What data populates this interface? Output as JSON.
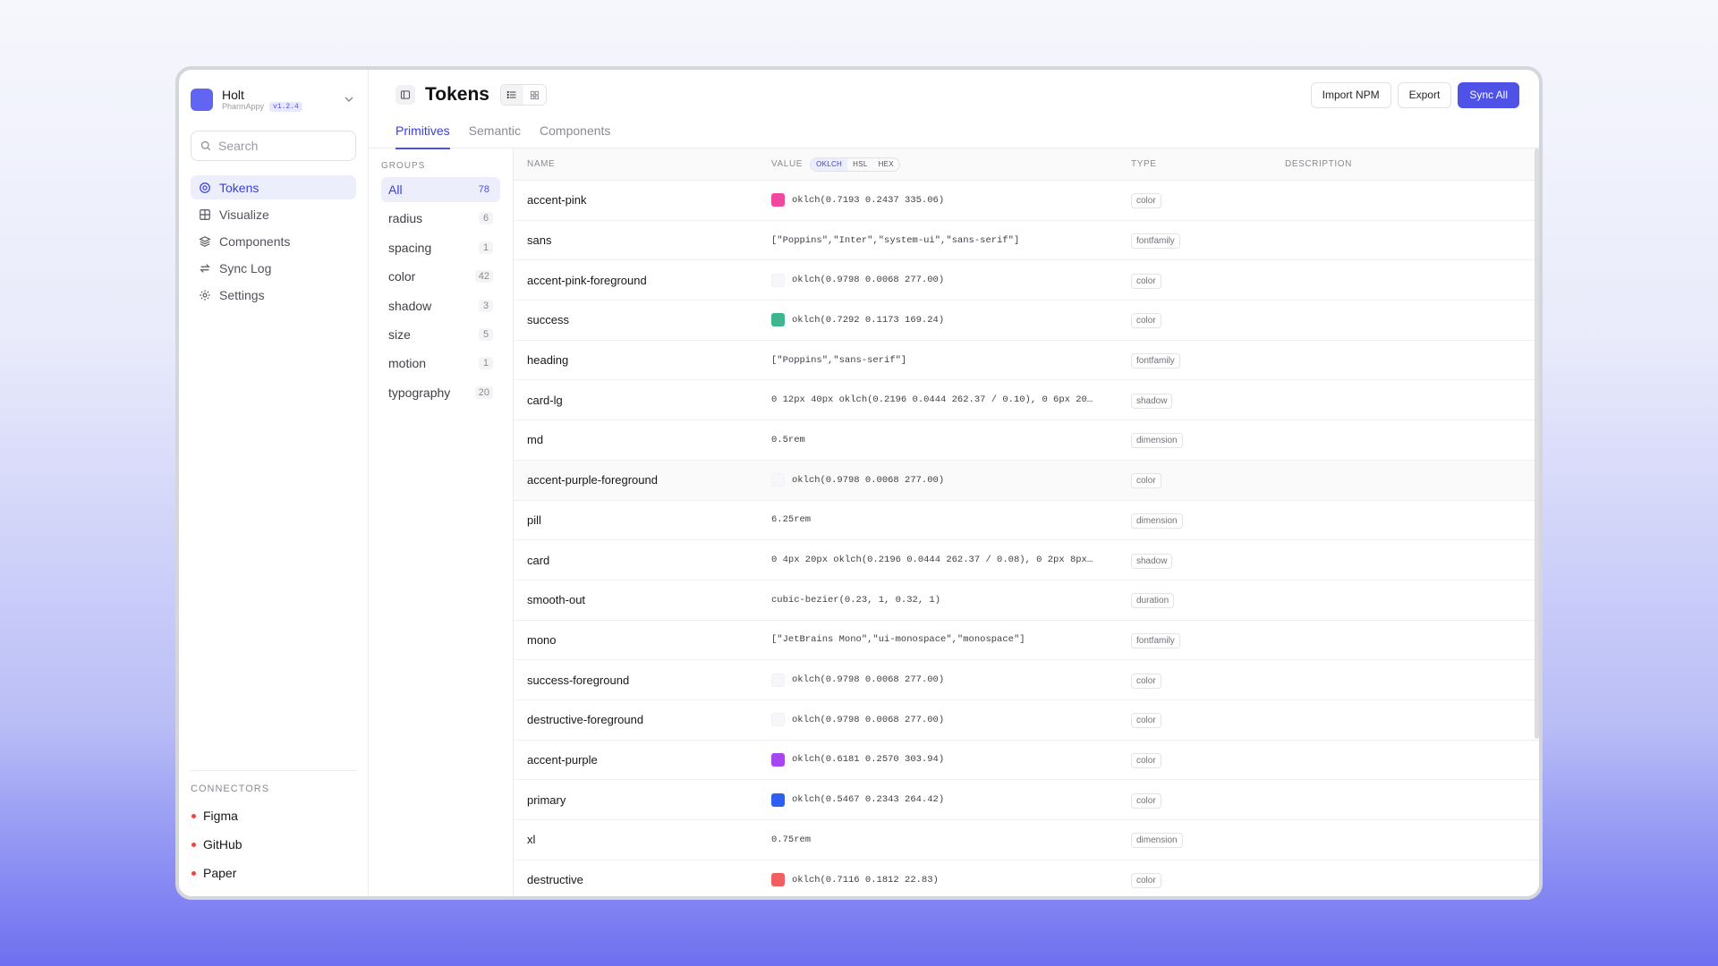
{
  "workspace": {
    "name": "Holt",
    "project": "PharmAppy",
    "version": "v1.2.4"
  },
  "search": {
    "placeholder": "Search"
  },
  "nav": [
    {
      "label": "Tokens",
      "icon": "target-icon",
      "active": true
    },
    {
      "label": "Visualize",
      "icon": "grid-icon",
      "active": false
    },
    {
      "label": "Components",
      "icon": "layers-icon",
      "active": false
    },
    {
      "label": "Sync Log",
      "icon": "sync-icon",
      "active": false
    },
    {
      "label": "Settings",
      "icon": "gear-icon",
      "active": false
    }
  ],
  "connectors": {
    "title": "CONNECTORS",
    "items": [
      "Figma",
      "GitHub",
      "Paper"
    ],
    "status_color": "#ef4444"
  },
  "header": {
    "title": "Tokens",
    "import_label": "Import NPM",
    "export_label": "Export",
    "sync_label": "Sync All"
  },
  "tabs": [
    {
      "label": "Primitives",
      "active": true
    },
    {
      "label": "Semantic",
      "active": false
    },
    {
      "label": "Components",
      "active": false
    }
  ],
  "groups": {
    "title": "GROUPS",
    "items": [
      {
        "label": "All",
        "count": "78",
        "active": true
      },
      {
        "label": "radius",
        "count": "6"
      },
      {
        "label": "spacing",
        "count": "1"
      },
      {
        "label": "color",
        "count": "42"
      },
      {
        "label": "shadow",
        "count": "3"
      },
      {
        "label": "size",
        "count": "5"
      },
      {
        "label": "motion",
        "count": "1"
      },
      {
        "label": "typography",
        "count": "20"
      }
    ]
  },
  "table": {
    "headers": {
      "name": "NAME",
      "value": "VALUE",
      "type": "TYPE",
      "description": "DESCRIPTION"
    },
    "formats": [
      "OKLCH",
      "HSL",
      "HEX"
    ],
    "active_format": "OKLCH",
    "rows": [
      {
        "name": "accent-pink",
        "value": "oklch(0.7193 0.2437 335.06)",
        "type": "color",
        "swatch": "#f0489f"
      },
      {
        "name": "sans",
        "value": "[\"Poppins\",\"Inter\",\"system-ui\",\"sans-serif\"]",
        "type": "fontfamily"
      },
      {
        "name": "accent-pink-foreground",
        "value": "oklch(0.9798 0.0068 277.00)",
        "type": "color",
        "swatch": "#f6f6fb"
      },
      {
        "name": "success",
        "value": "oklch(0.7292 0.1173 169.24)",
        "type": "color",
        "swatch": "#3fb58f"
      },
      {
        "name": "heading",
        "value": "[\"Poppins\",\"sans-serif\"]",
        "type": "fontfamily"
      },
      {
        "name": "card-lg",
        "value": "0 12px 40px oklch(0.2196 0.0444 262.37 / 0.10), 0 6px 20…",
        "type": "shadow"
      },
      {
        "name": "md",
        "value": "0.5rem",
        "type": "dimension"
      },
      {
        "name": "accent-purple-foreground",
        "value": "oklch(0.9798 0.0068 277.00)",
        "type": "color",
        "swatch": "#f6f6fb"
      },
      {
        "name": "pill",
        "value": "6.25rem",
        "type": "dimension"
      },
      {
        "name": "card",
        "value": "0 4px 20px oklch(0.2196 0.0444 262.37 / 0.08), 0 2px 8px…",
        "type": "shadow"
      },
      {
        "name": "smooth-out",
        "value": "cubic-bezier(0.23, 1, 0.32, 1)",
        "type": "duration"
      },
      {
        "name": "mono",
        "value": "[\"JetBrains Mono\",\"ui-monospace\",\"monospace\"]",
        "type": "fontfamily"
      },
      {
        "name": "success-foreground",
        "value": "oklch(0.9798 0.0068 277.00)",
        "type": "color",
        "swatch": "#f6f6fb"
      },
      {
        "name": "destructive-foreground",
        "value": "oklch(0.9798 0.0068 277.00)",
        "type": "color",
        "swatch": "#f6f6fb"
      },
      {
        "name": "accent-purple",
        "value": "oklch(0.6181 0.2570 303.94)",
        "type": "color",
        "swatch": "#a646f0"
      },
      {
        "name": "primary",
        "value": "oklch(0.5467 0.2343 264.42)",
        "type": "color",
        "swatch": "#2f5ff0"
      },
      {
        "name": "xl",
        "value": "0.75rem",
        "type": "dimension"
      },
      {
        "name": "destructive",
        "value": "oklch(0.7116 0.1812 22.83)",
        "type": "color",
        "swatch": "#f06060"
      }
    ]
  },
  "colors": {
    "accent": "#4f52e6",
    "active_bg": "#eceefc"
  }
}
